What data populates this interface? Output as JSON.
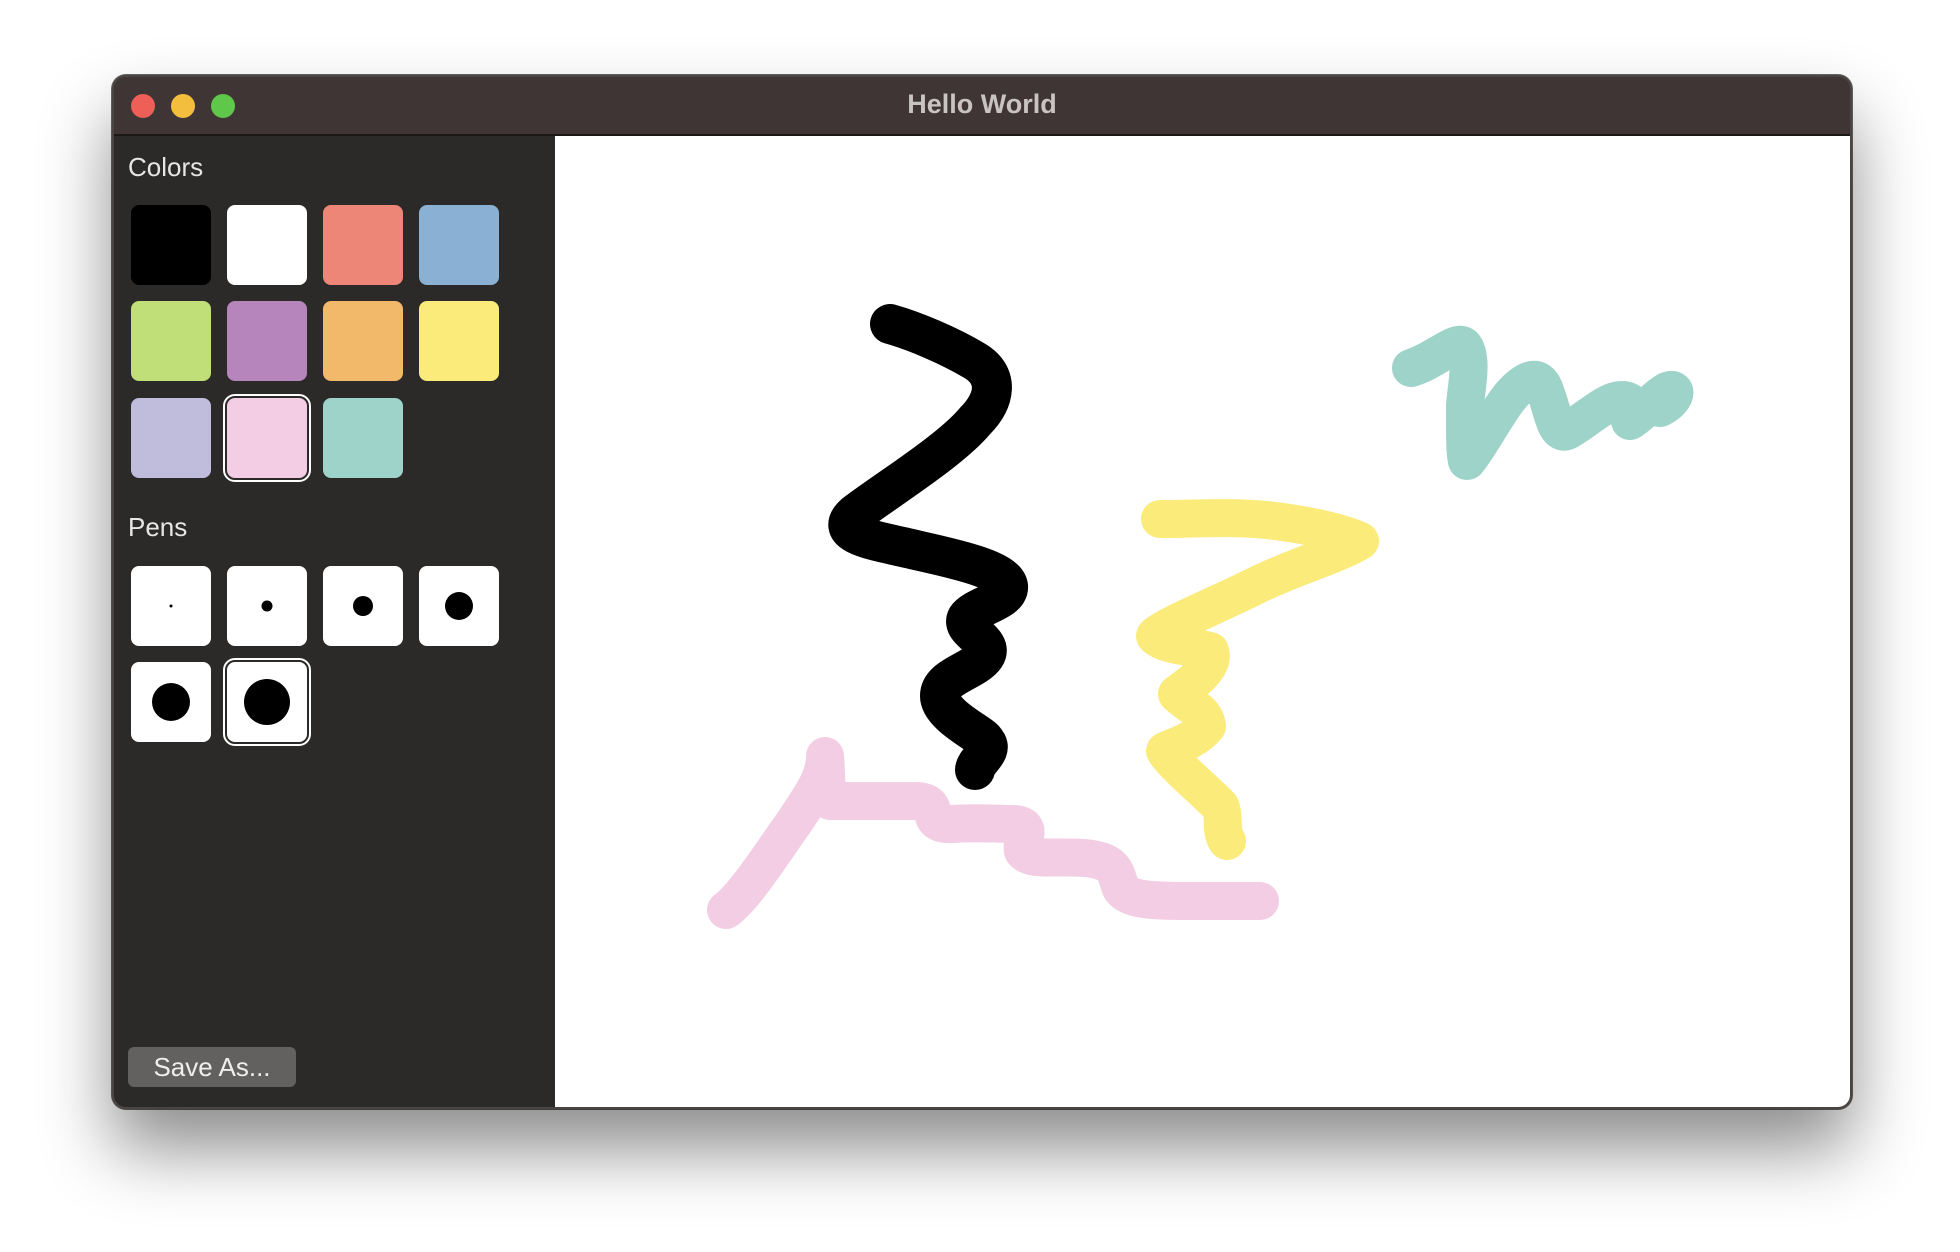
{
  "window": {
    "title": "Hello World"
  },
  "sidebar": {
    "colors_label": "Colors",
    "colors": [
      {
        "name": "black",
        "hex": "#000000"
      },
      {
        "name": "white",
        "hex": "#ffffff"
      },
      {
        "name": "salmon",
        "hex": "#ee8678"
      },
      {
        "name": "blue",
        "hex": "#8ab1d3"
      },
      {
        "name": "green",
        "hex": "#c0df78"
      },
      {
        "name": "purple",
        "hex": "#b585bc"
      },
      {
        "name": "orange",
        "hex": "#f2b96a"
      },
      {
        "name": "yellow",
        "hex": "#fbeb7a"
      },
      {
        "name": "lavender",
        "hex": "#bfbcdc"
      },
      {
        "name": "pink",
        "hex": "#f3cde3"
      },
      {
        "name": "teal",
        "hex": "#9dd3c8"
      }
    ],
    "selected_color": "pink",
    "pens_label": "Pens",
    "pens": [
      {
        "name": "pen-size-1"
      },
      {
        "name": "pen-size-2"
      },
      {
        "name": "pen-size-3"
      },
      {
        "name": "pen-size-4"
      },
      {
        "name": "pen-size-5"
      },
      {
        "name": "pen-size-6"
      }
    ],
    "selected_pen": "pen-size-6",
    "save_label": "Save As..."
  },
  "canvas": {
    "strokes": [
      {
        "name": "black-stroke",
        "color": "#000000"
      },
      {
        "name": "teal-stroke",
        "color": "#9dd3c8"
      },
      {
        "name": "yellow-stroke",
        "color": "#fbeb7a"
      },
      {
        "name": "pink-stroke",
        "color": "#f3cde3"
      }
    ]
  }
}
